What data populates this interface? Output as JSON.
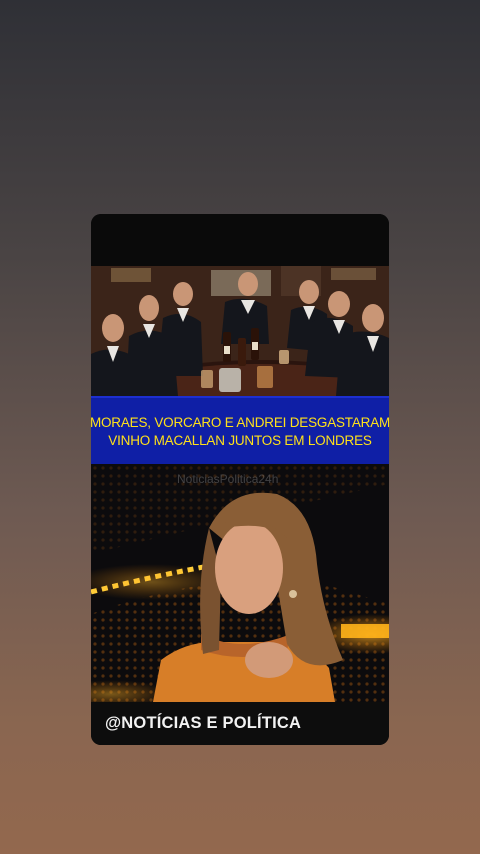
{
  "headline": {
    "line1": "MORAES, VORCARO E ANDREI DESGASTARAM",
    "line2": "VINHO MACALLAN JUNTOS EM LONDRES"
  },
  "watermark": "NoticiasPolitica24h",
  "handle": "@NOTÍCIAS E POLÍTICA",
  "colors": {
    "headline_bg": "#0f1fa6",
    "headline_text": "#ffe11a",
    "card_bg": "#0b0b0b"
  }
}
